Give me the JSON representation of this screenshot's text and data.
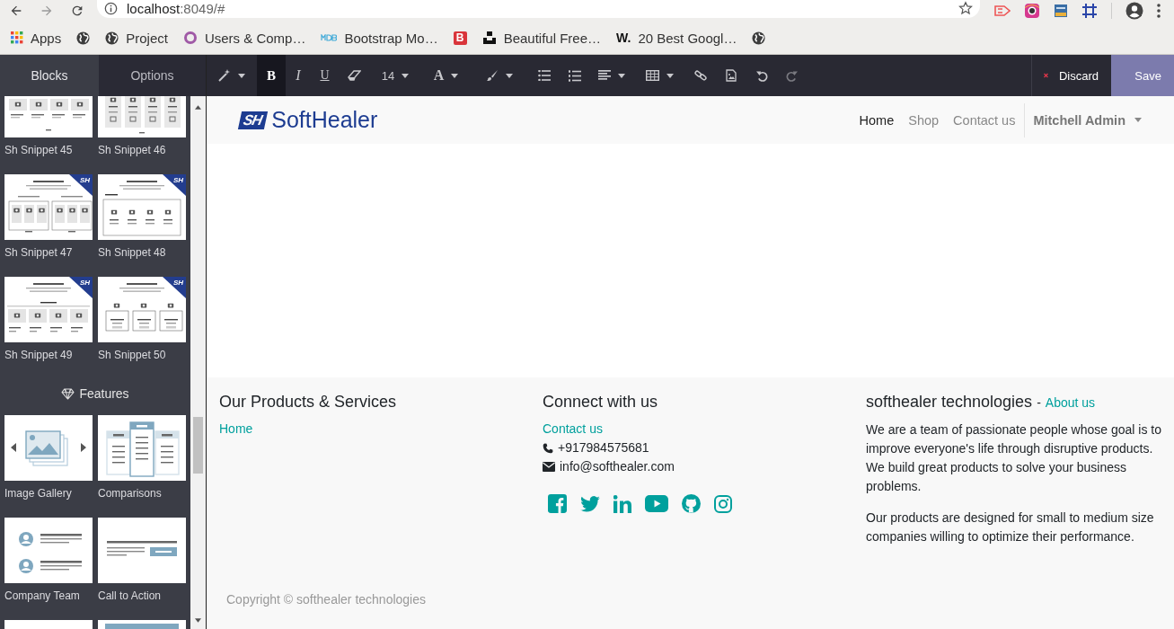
{
  "browser": {
    "address": {
      "host": "localhost",
      "rest": ":8049/#"
    },
    "extensions": [
      {
        "kind": "tag"
      },
      {
        "kind": "camera"
      },
      {
        "kind": "card"
      },
      {
        "kind": "crop"
      }
    ],
    "bookmarks": [
      {
        "kind": "apps",
        "label": "Apps"
      },
      {
        "kind": "globe"
      },
      {
        "kind": "globe",
        "label": "Project"
      },
      {
        "kind": "ring",
        "label": "Users & Comp…"
      },
      {
        "kind": "mdb",
        "label": "Bootstrap Mo…"
      },
      {
        "kind": "letter-red",
        "icon_text": "B"
      },
      {
        "kind": "blocks",
        "label": "Beautiful Free…"
      },
      {
        "kind": "letter-dark",
        "icon_text": "W.",
        "label": "20 Best Googl…"
      },
      {
        "kind": "globe"
      }
    ]
  },
  "sidebar": {
    "tabs": [
      {
        "label": "Blocks",
        "selected": true
      },
      {
        "label": "Options",
        "selected": false
      }
    ],
    "sections": [
      {
        "items": [
          {
            "label": "Sh Snippet 45",
            "kind": "cards"
          },
          {
            "label": "Sh Snippet 46",
            "kind": "columns"
          },
          {
            "label": "Sh Snippet 47",
            "kind": "boxes",
            "badge": "SH"
          },
          {
            "label": "Sh Snippet 48",
            "kind": "panel",
            "badge": "SH"
          },
          {
            "label": "Sh Snippet 49",
            "kind": "strip",
            "badge": "SH"
          },
          {
            "label": "Sh Snippet 50",
            "kind": "trio",
            "badge": "SH"
          }
        ]
      },
      {
        "title": "Features",
        "items": [
          {
            "label": "Image Gallery",
            "kind": "gallery"
          },
          {
            "label": "Comparisons",
            "kind": "comparisons"
          },
          {
            "label": "Company Team",
            "kind": "team"
          },
          {
            "label": "Call to Action",
            "kind": "cta"
          },
          {
            "kind": "blank"
          },
          {
            "kind": "banner"
          }
        ]
      }
    ]
  },
  "toolbar": {
    "tools": [
      {
        "kind": "wand",
        "dropdown": true,
        "active": false,
        "disabled": false
      },
      {
        "kind": "bold",
        "text": "B",
        "dropdown": false,
        "active": true,
        "disabled": false
      },
      {
        "kind": "italic",
        "text": "I",
        "dropdown": false,
        "active": false,
        "disabled": false
      },
      {
        "kind": "underline",
        "text": "U",
        "dropdown": false,
        "active": false,
        "disabled": false
      },
      {
        "kind": "eraser",
        "dropdown": false,
        "active": false,
        "disabled": false
      },
      {
        "kind": "size",
        "text": "14",
        "dropdown": true,
        "active": false,
        "disabled": false
      },
      {
        "kind": "color",
        "text": "A",
        "dropdown": true,
        "active": false,
        "disabled": false
      },
      {
        "kind": "brush",
        "dropdown": true,
        "active": false,
        "disabled": false
      },
      {
        "kind": "ul",
        "dropdown": false,
        "active": false,
        "disabled": false
      },
      {
        "kind": "ol",
        "dropdown": false,
        "active": false,
        "disabled": false
      },
      {
        "kind": "align",
        "dropdown": true,
        "active": false,
        "disabled": false
      },
      {
        "kind": "table",
        "dropdown": true,
        "active": false,
        "disabled": false
      },
      {
        "kind": "link",
        "dropdown": false,
        "active": false,
        "disabled": false
      },
      {
        "kind": "image",
        "dropdown": false,
        "active": false,
        "disabled": false
      },
      {
        "kind": "undo",
        "dropdown": false,
        "active": false,
        "disabled": false
      },
      {
        "kind": "redo",
        "dropdown": false,
        "active": false,
        "disabled": true
      }
    ],
    "actions": [
      {
        "kind": "discard",
        "label": "Discard"
      },
      {
        "kind": "save",
        "label": "Save"
      }
    ]
  },
  "site": {
    "logo": {
      "mark": "SH",
      "name": "SoftHealer"
    },
    "nav": [
      {
        "label": "Home",
        "selected": true
      },
      {
        "label": "Shop",
        "selected": false
      },
      {
        "label": "Contact us",
        "selected": false
      }
    ],
    "user": "Mitchell Admin",
    "footer": {
      "columns": [
        {
          "title": "Our Products & Services",
          "links": [
            "Home"
          ]
        },
        {
          "title": "Connect with us",
          "links": [
            "Contact us"
          ],
          "contacts": [
            {
              "kind": "phone",
              "text": "+917984575681"
            },
            {
              "kind": "email",
              "text": "info@softhealer.com"
            }
          ],
          "social": [
            {
              "kind": "facebook"
            },
            {
              "kind": "twitter"
            },
            {
              "kind": "linkedin"
            },
            {
              "kind": "youtube"
            },
            {
              "kind": "github"
            },
            {
              "kind": "instagram"
            }
          ]
        },
        {
          "title": "softhealer technologies",
          "separator": "-",
          "title_link": "About us",
          "paragraphs": [
            "We are a team of passionate people whose goal is to improve everyone's life through disruptive products. We build great products to solve your business problems.",
            "Our products are designed for small to medium size companies willing to optimize their performance."
          ]
        }
      ],
      "copyright": "Copyright © softhealer technologies"
    }
  }
}
